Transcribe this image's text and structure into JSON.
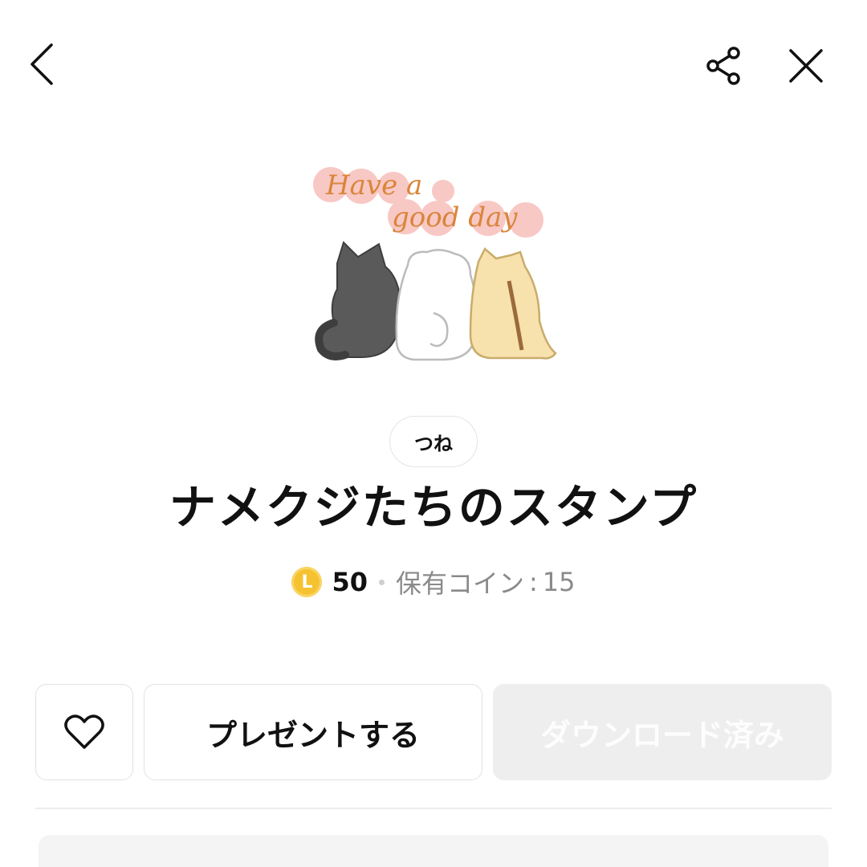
{
  "header": {
    "back_icon": "chevron-left-icon",
    "share_icon": "share-icon",
    "close_icon": "close-icon"
  },
  "sticker": {
    "image_text": "Have a good day",
    "image_description": "three cats seen from behind"
  },
  "author": "つね",
  "title": "ナメクジたちのスタンプ",
  "price": {
    "coin_icon_letter": "L",
    "amount": "50",
    "owned_label": "保有コイン",
    "owned_separator": ":",
    "owned_value": "15"
  },
  "actions": {
    "like_icon": "heart-icon",
    "gift_label": "プレゼントする",
    "download_label": "ダウンロード済み"
  },
  "colors": {
    "coin": "#f6c230",
    "disabled_button": "#eeeeee",
    "owned_text": "#8a8a8a"
  }
}
